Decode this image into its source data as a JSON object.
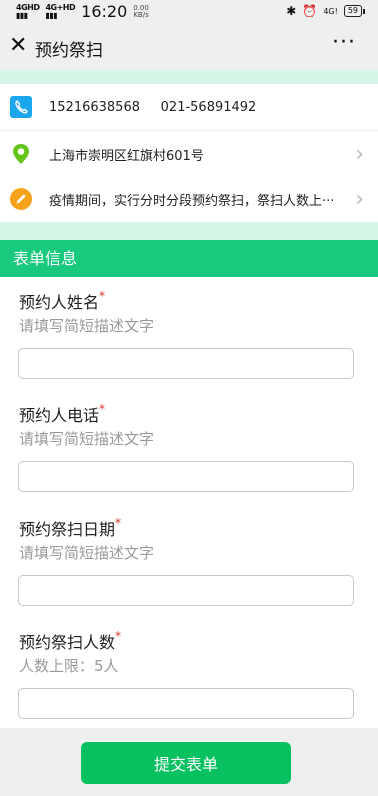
{
  "status_bar": {
    "signal1": "4GHD",
    "signal2": "4G+HD",
    "time": "16:20",
    "speed_value": "0.00",
    "speed_unit": "KB/s",
    "net_label": "4G!",
    "battery": "59"
  },
  "header": {
    "title": "预约祭扫"
  },
  "contact": {
    "phone": "15216638568",
    "tel": "021-56891492",
    "address": "上海市崇明区红旗村601号",
    "notice": "疫情期间，实行分时分段预约祭扫，祭扫人数上···"
  },
  "form": {
    "section_title": "表单信息",
    "fields": [
      {
        "label": "预约人姓名",
        "required_mark": "*",
        "desc": "请填写简短描述文字",
        "value": ""
      },
      {
        "label": "预约人电话",
        "required_mark": "*",
        "desc": "请填写简短描述文字",
        "value": ""
      },
      {
        "label": "预约祭扫日期",
        "required_mark": "*",
        "desc": "请填写简短描述文字",
        "value": ""
      },
      {
        "label": "预约祭扫人数",
        "required_mark": "*",
        "desc": "人数上限：5人",
        "value": ""
      }
    ],
    "submit_label": "提交表单"
  },
  "colors": {
    "accent": "#19c97e",
    "button": "#07c160",
    "mint": "#d6f6e8",
    "phone_icon": "#1aa7ee",
    "location_icon": "#66c51a",
    "notice_icon": "#f7a21b"
  }
}
